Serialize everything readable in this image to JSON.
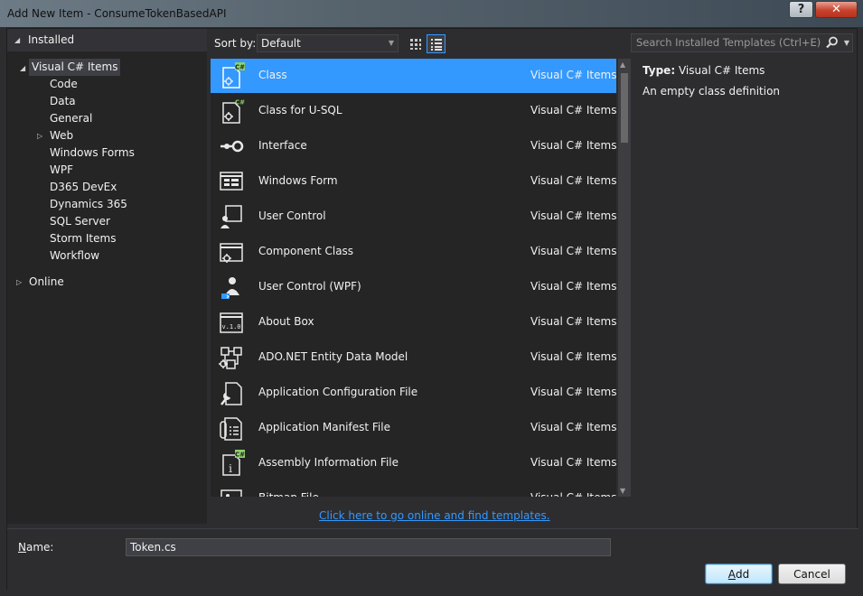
{
  "window": {
    "title": "Add New Item - ConsumeTokenBasedAPI",
    "help_label": "?",
    "close_label": "✕"
  },
  "tree": {
    "installed_label": "Installed",
    "root_label": "Visual C# Items",
    "children": [
      "Code",
      "Data",
      "General",
      "Web",
      "Windows Forms",
      "WPF",
      "D365 DevEx",
      "Dynamics 365",
      "SQL Server",
      "Storm Items",
      "Workflow"
    ],
    "online_label": "Online"
  },
  "toolbar": {
    "sort_label": "Sort by:",
    "sort_value": "Default",
    "search_placeholder": "Search Installed Templates (Ctrl+E)"
  },
  "items": [
    {
      "name": "Class",
      "category": "Visual C# Items",
      "icon": "class-icon",
      "selected": true
    },
    {
      "name": "Class for U-SQL",
      "category": "Visual C# Items",
      "icon": "usql-class-icon"
    },
    {
      "name": "Interface",
      "category": "Visual C# Items",
      "icon": "interface-icon"
    },
    {
      "name": "Windows Form",
      "category": "Visual C# Items",
      "icon": "windows-form-icon"
    },
    {
      "name": "User Control",
      "category": "Visual C# Items",
      "icon": "user-control-icon"
    },
    {
      "name": "Component Class",
      "category": "Visual C# Items",
      "icon": "component-class-icon"
    },
    {
      "name": "User Control (WPF)",
      "category": "Visual C# Items",
      "icon": "wpf-user-control-icon"
    },
    {
      "name": "About Box",
      "category": "Visual C# Items",
      "icon": "about-box-icon"
    },
    {
      "name": "ADO.NET Entity Data Model",
      "category": "Visual C# Items",
      "icon": "entity-model-icon"
    },
    {
      "name": "Application Configuration File",
      "category": "Visual C# Items",
      "icon": "config-file-icon"
    },
    {
      "name": "Application Manifest File",
      "category": "Visual C# Items",
      "icon": "manifest-file-icon"
    },
    {
      "name": "Assembly Information File",
      "category": "Visual C# Items",
      "icon": "assembly-info-icon"
    },
    {
      "name": "Bitmap File",
      "category": "Visual C# Items",
      "icon": "bitmap-file-icon"
    }
  ],
  "details": {
    "type_label": "Type:",
    "type_value": "Visual C# Items",
    "description": "An empty class definition"
  },
  "online_link": "Click here to go online and find templates.",
  "footer": {
    "name_label_prefix": "N",
    "name_label_rest": "ame:",
    "name_value": "Token.cs",
    "add_label_prefix": "A",
    "add_label_rest": "dd",
    "cancel_label": "Cancel"
  },
  "colors": {
    "accent": "#3399ff",
    "background": "#2d2d30",
    "panel": "#252526",
    "text": "#f1f1f1",
    "csharp_badge": "#8ed16b"
  }
}
